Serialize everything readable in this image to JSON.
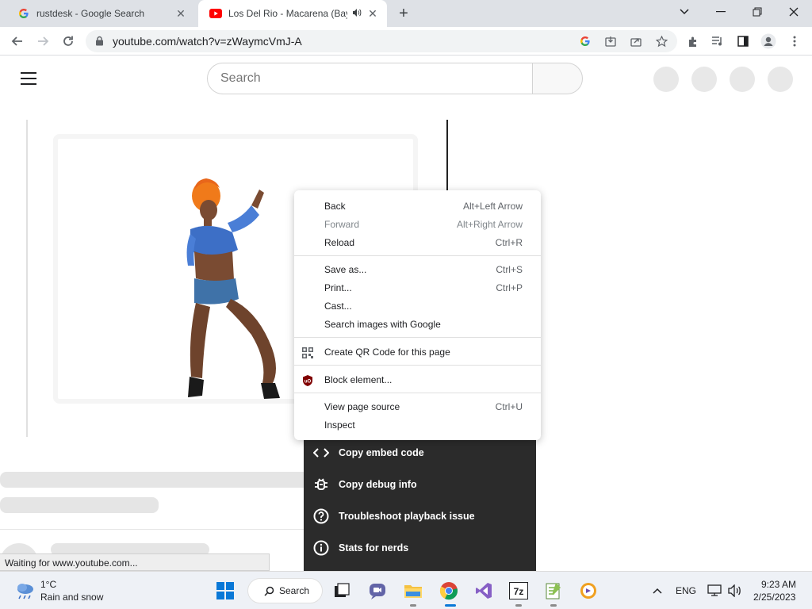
{
  "browser": {
    "tabs": [
      {
        "title": "rustdesk - Google Search",
        "favicon": "google-g-icon"
      },
      {
        "title": "Los Del Rio - Macarena (Bayside",
        "favicon": "youtube-icon",
        "audio": "speaker-icon"
      }
    ],
    "new_tab_label": "+",
    "url": "youtube.com/watch?v=zWaymcVmJ-A"
  },
  "youtube": {
    "search_placeholder": "Search",
    "menu": [
      {
        "label": "Copy embed code",
        "icon": "code-icon"
      },
      {
        "label": "Copy debug info",
        "icon": "bug-icon"
      },
      {
        "label": "Troubleshoot playback issue",
        "icon": "help-circle-icon"
      },
      {
        "label": "Stats for nerds",
        "icon": "info-icon"
      }
    ]
  },
  "context_menu": {
    "items": [
      {
        "label": "Back",
        "shortcut": "Alt+Left Arrow"
      },
      {
        "label": "Forward",
        "shortcut": "Alt+Right Arrow",
        "disabled": true
      },
      {
        "label": "Reload",
        "shortcut": "Ctrl+R"
      },
      {
        "label": "Save as...",
        "shortcut": "Ctrl+S"
      },
      {
        "label": "Print...",
        "shortcut": "Ctrl+P"
      },
      {
        "label": "Cast...",
        "shortcut": ""
      },
      {
        "label": "Search images with Google",
        "shortcut": ""
      },
      {
        "label": "Create QR Code for this page",
        "shortcut": "",
        "icon": "qr-code-icon"
      },
      {
        "label": "Block element...",
        "shortcut": "",
        "icon": "ublock-origin-icon"
      },
      {
        "label": "View page source",
        "shortcut": "Ctrl+U"
      },
      {
        "label": "Inspect",
        "shortcut": ""
      }
    ]
  },
  "status_bar": "Waiting for www.youtube.com...",
  "taskbar": {
    "weather_temp": "1°C",
    "weather_desc": "Rain and snow",
    "search_label": "Search",
    "language": "ENG",
    "time": "9:23 AM",
    "date": "2/25/2023"
  },
  "colors": {
    "tabstrip": "#dee1e6",
    "youtube_red": "#ff0000",
    "yt_menu_bg": "#2b2b2b",
    "taskbar": "#eef1f6"
  }
}
